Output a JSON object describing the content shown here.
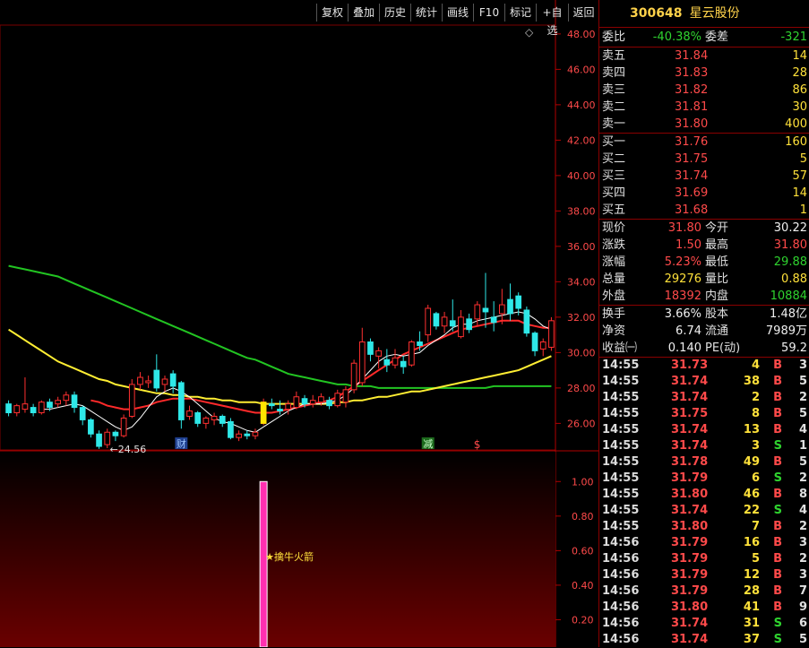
{
  "toolbar": [
    "复权",
    "叠加",
    "历史",
    "统计",
    "画线",
    "F10",
    "标记",
    "+自选",
    "返回"
  ],
  "diamond_icon": "◇",
  "price_axis": [
    "48.00",
    "46.00",
    "44.00",
    "42.00",
    "40.00",
    "38.00",
    "36.00",
    "34.00",
    "32.00",
    "30.00",
    "28.00",
    "26.00"
  ],
  "indicator_axis": [
    "1.00",
    "0.80",
    "0.60",
    "0.40",
    "0.20"
  ],
  "chart_labels": {
    "low_marker": "←24.56",
    "cai_badge": "财",
    "jian_badge": "减",
    "s_badge": "$",
    "signal_label": "★擒牛火箭"
  },
  "chart_data": {
    "type": "candlestick",
    "ylim": [
      24.5,
      48.5
    ],
    "candles": [
      {
        "o": 27.1,
        "c": 26.6,
        "h": 27.3,
        "l": 26.4
      },
      {
        "o": 26.6,
        "c": 27.0,
        "h": 27.1,
        "l": 26.4
      },
      {
        "o": 26.8,
        "c": 27.1,
        "h": 28.6,
        "l": 26.6
      },
      {
        "o": 26.9,
        "c": 26.6,
        "h": 27.1,
        "l": 26.4
      },
      {
        "o": 26.6,
        "c": 27.2,
        "h": 27.3,
        "l": 26.5
      },
      {
        "o": 27.2,
        "c": 26.9,
        "h": 27.4,
        "l": 26.7
      },
      {
        "o": 27.1,
        "c": 27.3,
        "h": 27.5,
        "l": 26.9
      },
      {
        "o": 27.3,
        "c": 27.6,
        "h": 27.8,
        "l": 27.0
      },
      {
        "o": 27.6,
        "c": 26.9,
        "h": 27.8,
        "l": 26.6
      },
      {
        "o": 26.9,
        "c": 26.2,
        "h": 27.0,
        "l": 25.9
      },
      {
        "o": 26.2,
        "c": 25.4,
        "h": 26.3,
        "l": 25.2
      },
      {
        "o": 25.4,
        "c": 24.7,
        "h": 25.6,
        "l": 24.56
      },
      {
        "o": 24.8,
        "c": 25.5,
        "h": 25.7,
        "l": 24.6
      },
      {
        "o": 25.5,
        "c": 25.3,
        "h": 25.6,
        "l": 25.0
      },
      {
        "o": 25.3,
        "c": 26.3,
        "h": 26.5,
        "l": 25.2
      },
      {
        "o": 26.4,
        "c": 28.2,
        "h": 28.5,
        "l": 26.3
      },
      {
        "o": 28.2,
        "c": 28.6,
        "h": 28.9,
        "l": 27.9
      },
      {
        "o": 28.3,
        "c": 28.4,
        "h": 28.7,
        "l": 28.0
      },
      {
        "o": 29.0,
        "c": 28.0,
        "h": 29.9,
        "l": 27.8
      },
      {
        "o": 28.2,
        "c": 28.5,
        "h": 28.7,
        "l": 27.8
      },
      {
        "o": 28.8,
        "c": 28.1,
        "h": 29.0,
        "l": 27.7
      },
      {
        "o": 28.3,
        "c": 26.2,
        "h": 28.4,
        "l": 25.7
      },
      {
        "o": 26.4,
        "c": 26.7,
        "h": 27.0,
        "l": 26.2
      },
      {
        "o": 26.6,
        "c": 26.0,
        "h": 26.7,
        "l": 25.8
      },
      {
        "o": 26.0,
        "c": 26.3,
        "h": 26.4,
        "l": 25.7
      },
      {
        "o": 26.2,
        "c": 26.4,
        "h": 26.6,
        "l": 25.9
      },
      {
        "o": 26.4,
        "c": 26.0,
        "h": 26.5,
        "l": 25.8
      },
      {
        "o": 26.1,
        "c": 25.2,
        "h": 26.3,
        "l": 25.1
      },
      {
        "o": 25.2,
        "c": 25.4,
        "h": 25.6,
        "l": 25.0
      },
      {
        "o": 25.4,
        "c": 25.3,
        "h": 25.6,
        "l": 25.1
      },
      {
        "o": 25.3,
        "c": 25.5,
        "h": 25.7,
        "l": 25.1
      },
      {
        "o": 26.0,
        "c": 27.2,
        "h": 27.4,
        "l": 25.9
      },
      {
        "o": 27.1,
        "c": 27.0,
        "h": 27.4,
        "l": 26.8
      },
      {
        "o": 26.8,
        "c": 26.7,
        "h": 27.3,
        "l": 26.5
      },
      {
        "o": 26.8,
        "c": 27.1,
        "h": 27.3,
        "l": 26.5
      },
      {
        "o": 26.9,
        "c": 27.5,
        "h": 27.8,
        "l": 26.8
      },
      {
        "o": 27.4,
        "c": 27.1,
        "h": 27.6,
        "l": 26.9
      },
      {
        "o": 27.1,
        "c": 27.3,
        "h": 27.6,
        "l": 26.9
      },
      {
        "o": 27.2,
        "c": 27.5,
        "h": 27.7,
        "l": 27.0
      },
      {
        "o": 27.3,
        "c": 27.0,
        "h": 27.5,
        "l": 26.8
      },
      {
        "o": 27.0,
        "c": 27.7,
        "h": 27.9,
        "l": 26.9
      },
      {
        "o": 27.2,
        "c": 27.9,
        "h": 28.1,
        "l": 26.9
      },
      {
        "o": 27.9,
        "c": 29.4,
        "h": 29.6,
        "l": 27.7
      },
      {
        "o": 28.3,
        "c": 30.6,
        "h": 31.4,
        "l": 28.1
      },
      {
        "o": 30.6,
        "c": 29.9,
        "h": 30.8,
        "l": 29.5
      },
      {
        "o": 29.8,
        "c": 30.1,
        "h": 30.3,
        "l": 29.1
      },
      {
        "o": 29.6,
        "c": 29.3,
        "h": 30.2,
        "l": 28.9
      },
      {
        "o": 29.3,
        "c": 29.7,
        "h": 30.2,
        "l": 29.1
      },
      {
        "o": 29.5,
        "c": 29.2,
        "h": 29.8,
        "l": 28.8
      },
      {
        "o": 29.3,
        "c": 30.6,
        "h": 30.7,
        "l": 29.2
      },
      {
        "o": 30.6,
        "c": 30.4,
        "h": 31.2,
        "l": 30.1
      },
      {
        "o": 31.0,
        "c": 32.5,
        "h": 32.7,
        "l": 30.6
      },
      {
        "o": 32.2,
        "c": 31.5,
        "h": 32.3,
        "l": 31.3
      },
      {
        "o": 31.5,
        "c": 32.0,
        "h": 32.3,
        "l": 31.1
      },
      {
        "o": 31.8,
        "c": 31.5,
        "h": 33.0,
        "l": 31.2
      },
      {
        "o": 30.9,
        "c": 32.0,
        "h": 32.4,
        "l": 30.8
      },
      {
        "o": 31.9,
        "c": 31.3,
        "h": 32.2,
        "l": 31.1
      },
      {
        "o": 31.9,
        "c": 32.7,
        "h": 32.9,
        "l": 31.5
      },
      {
        "o": 32.5,
        "c": 32.3,
        "h": 34.5,
        "l": 31.4
      },
      {
        "o": 32.0,
        "c": 31.7,
        "h": 32.9,
        "l": 31.2
      },
      {
        "o": 32.2,
        "c": 32.7,
        "h": 33.6,
        "l": 31.6
      },
      {
        "o": 33.0,
        "c": 32.2,
        "h": 33.9,
        "l": 31.8
      },
      {
        "o": 33.2,
        "c": 32.5,
        "h": 33.4,
        "l": 32.1
      },
      {
        "o": 32.4,
        "c": 31.1,
        "h": 32.6,
        "l": 30.9
      },
      {
        "o": 31.1,
        "c": 30.1,
        "h": 31.2,
        "l": 29.8
      },
      {
        "o": 30.2,
        "c": 30.6,
        "h": 30.8,
        "l": 29.8
      },
      {
        "o": 30.3,
        "c": 31.8,
        "h": 32.0,
        "l": 30.1
      }
    ],
    "ma_white": [
      null,
      null,
      null,
      null,
      26.8,
      26.8,
      26.9,
      27.0,
      27.1,
      27.0,
      26.7,
      26.4,
      26.1,
      25.8,
      25.6,
      25.8,
      26.3,
      26.9,
      27.5,
      27.8,
      28.0,
      27.8,
      27.5,
      27.1,
      26.7,
      26.3,
      26.1,
      26.0,
      25.8,
      25.6,
      25.5,
      25.8,
      26.1,
      26.4,
      26.7,
      26.9,
      27.1,
      27.1,
      27.1,
      27.2,
      27.3,
      27.6,
      28.0,
      28.5,
      29.0,
      29.5,
      29.8,
      29.9,
      29.8,
      29.9,
      30.0,
      30.4,
      30.7,
      31.0,
      31.4,
      31.6,
      31.6,
      31.8,
      31.9,
      32.0,
      32.1,
      32.2,
      32.3,
      32.2,
      31.9,
      31.5,
      31.3
    ],
    "ma_red": [
      null,
      null,
      null,
      null,
      null,
      null,
      null,
      null,
      null,
      null,
      27.3,
      27.2,
      27.0,
      26.9,
      26.8,
      26.8,
      26.9,
      27.0,
      27.2,
      27.3,
      27.4,
      27.4,
      27.4,
      27.3,
      27.2,
      27.1,
      27.0,
      26.9,
      26.8,
      26.7,
      26.6,
      26.6,
      26.6,
      26.7,
      26.8,
      26.9,
      27.0,
      27.1,
      27.2,
      27.3,
      27.5,
      27.8,
      28.1,
      28.4,
      28.7,
      29.0,
      29.3,
      29.6,
      29.9,
      30.1,
      30.3,
      30.5,
      30.7,
      30.9,
      31.1,
      31.3,
      31.4,
      31.5,
      31.6,
      31.7,
      31.8,
      31.8,
      31.8,
      31.6,
      31.5,
      31.4,
      31.4
    ],
    "ma_yellow": [
      31.3,
      31.0,
      30.7,
      30.4,
      30.1,
      29.8,
      29.5,
      29.3,
      29.1,
      28.9,
      28.7,
      28.5,
      28.4,
      28.2,
      28.1,
      28.0,
      27.9,
      27.8,
      27.7,
      27.7,
      27.6,
      27.6,
      27.5,
      27.5,
      27.4,
      27.4,
      27.3,
      27.3,
      27.2,
      27.2,
      27.2,
      27.1,
      27.1,
      27.1,
      27.1,
      27.1,
      27.1,
      27.1,
      27.1,
      27.1,
      27.2,
      27.2,
      27.3,
      27.3,
      27.4,
      27.5,
      27.5,
      27.6,
      27.7,
      27.8,
      27.8,
      27.9,
      28.0,
      28.1,
      28.2,
      28.3,
      28.4,
      28.5,
      28.6,
      28.7,
      28.8,
      28.9,
      29.0,
      29.2,
      29.4,
      29.6,
      29.8
    ],
    "ma_green": [
      34.9,
      34.8,
      34.7,
      34.6,
      34.5,
      34.4,
      34.3,
      34.1,
      33.9,
      33.7,
      33.5,
      33.3,
      33.1,
      32.9,
      32.7,
      32.5,
      32.3,
      32.1,
      31.9,
      31.7,
      31.5,
      31.3,
      31.1,
      30.9,
      30.7,
      30.5,
      30.3,
      30.1,
      29.9,
      29.7,
      29.6,
      29.4,
      29.2,
      29.0,
      28.8,
      28.7,
      28.6,
      28.5,
      28.4,
      28.3,
      28.2,
      28.2,
      28.1,
      28.1,
      28.1,
      28.0,
      28.0,
      28.0,
      28.0,
      28.0,
      28.0,
      28.0,
      28.0,
      28.0,
      28.0,
      28.0,
      28.0,
      28.0,
      28.0,
      28.1,
      28.1,
      28.1,
      28.1,
      28.1,
      28.1,
      28.1,
      28.1
    ],
    "indicator": {
      "signal_index": 31,
      "value": 1.0,
      "ylim": [
        0,
        1.1
      ]
    }
  },
  "panel": {
    "code": "300648",
    "name": "星云股份",
    "weibi": {
      "label": "委比",
      "value": "-40.38%",
      "label2": "委差",
      "value2": "-321"
    },
    "sells": [
      {
        "label": "卖五",
        "price": "31.84",
        "vol": "14"
      },
      {
        "label": "卖四",
        "price": "31.83",
        "vol": "28"
      },
      {
        "label": "卖三",
        "price": "31.82",
        "vol": "86"
      },
      {
        "label": "卖二",
        "price": "31.81",
        "vol": "30"
      },
      {
        "label": "卖一",
        "price": "31.80",
        "vol": "400"
      }
    ],
    "buys": [
      {
        "label": "买一",
        "price": "31.76",
        "vol": "160"
      },
      {
        "label": "买二",
        "price": "31.75",
        "vol": "5"
      },
      {
        "label": "买三",
        "price": "31.74",
        "vol": "57"
      },
      {
        "label": "买四",
        "price": "31.69",
        "vol": "14"
      },
      {
        "label": "买五",
        "price": "31.68",
        "vol": "1"
      }
    ],
    "stats": [
      {
        "l1": "现价",
        "v1": "31.80",
        "c1": "red",
        "l2": "今开",
        "v2": "30.22",
        "c2": "white"
      },
      {
        "l1": "涨跌",
        "v1": "1.50",
        "c1": "red",
        "l2": "最高",
        "v2": "31.80",
        "c2": "red"
      },
      {
        "l1": "涨幅",
        "v1": "5.23%",
        "c1": "red",
        "l2": "最低",
        "v2": "29.88",
        "c2": "green"
      },
      {
        "l1": "总量",
        "v1": "29276",
        "c1": "yellow",
        "l2": "量比",
        "v2": "0.88",
        "c2": "yellow"
      },
      {
        "l1": "外盘",
        "v1": "18392",
        "c1": "red",
        "l2": "内盘",
        "v2": "10884",
        "c2": "green"
      }
    ],
    "fin": [
      {
        "l1": "换手",
        "v1": "3.66%",
        "l2": "股本",
        "v2": "1.48亿"
      },
      {
        "l1": "净资",
        "v1": "6.74",
        "l2": "流通",
        "v2": "7989万"
      },
      {
        "l1": "收益㈠",
        "v1": "0.140",
        "l2": "PE(动)",
        "v2": "59.2"
      }
    ],
    "ticks": [
      {
        "t": "14:55",
        "p": "31.73",
        "v": "4",
        "s": "B",
        "n": "3"
      },
      {
        "t": "14:55",
        "p": "31.74",
        "v": "38",
        "s": "B",
        "n": "5"
      },
      {
        "t": "14:55",
        "p": "31.74",
        "v": "2",
        "s": "B",
        "n": "2"
      },
      {
        "t": "14:55",
        "p": "31.75",
        "v": "8",
        "s": "B",
        "n": "5"
      },
      {
        "t": "14:55",
        "p": "31.74",
        "v": "13",
        "s": "B",
        "n": "4"
      },
      {
        "t": "14:55",
        "p": "31.74",
        "v": "3",
        "s": "S",
        "n": "1"
      },
      {
        "t": "14:55",
        "p": "31.78",
        "v": "49",
        "s": "B",
        "n": "5"
      },
      {
        "t": "14:55",
        "p": "31.79",
        "v": "6",
        "s": "S",
        "n": "2"
      },
      {
        "t": "14:55",
        "p": "31.80",
        "v": "46",
        "s": "B",
        "n": "8"
      },
      {
        "t": "14:55",
        "p": "31.74",
        "v": "22",
        "s": "S",
        "n": "4"
      },
      {
        "t": "14:55",
        "p": "31.80",
        "v": "7",
        "s": "B",
        "n": "2"
      },
      {
        "t": "14:56",
        "p": "31.79",
        "v": "16",
        "s": "B",
        "n": "3"
      },
      {
        "t": "14:56",
        "p": "31.79",
        "v": "5",
        "s": "B",
        "n": "2"
      },
      {
        "t": "14:56",
        "p": "31.79",
        "v": "12",
        "s": "B",
        "n": "3"
      },
      {
        "t": "14:56",
        "p": "31.79",
        "v": "28",
        "s": "B",
        "n": "7"
      },
      {
        "t": "14:56",
        "p": "31.80",
        "v": "41",
        "s": "B",
        "n": "9"
      },
      {
        "t": "14:56",
        "p": "31.74",
        "v": "31",
        "s": "S",
        "n": "6"
      },
      {
        "t": "14:56",
        "p": "31.74",
        "v": "37",
        "s": "S",
        "n": "5"
      }
    ]
  }
}
